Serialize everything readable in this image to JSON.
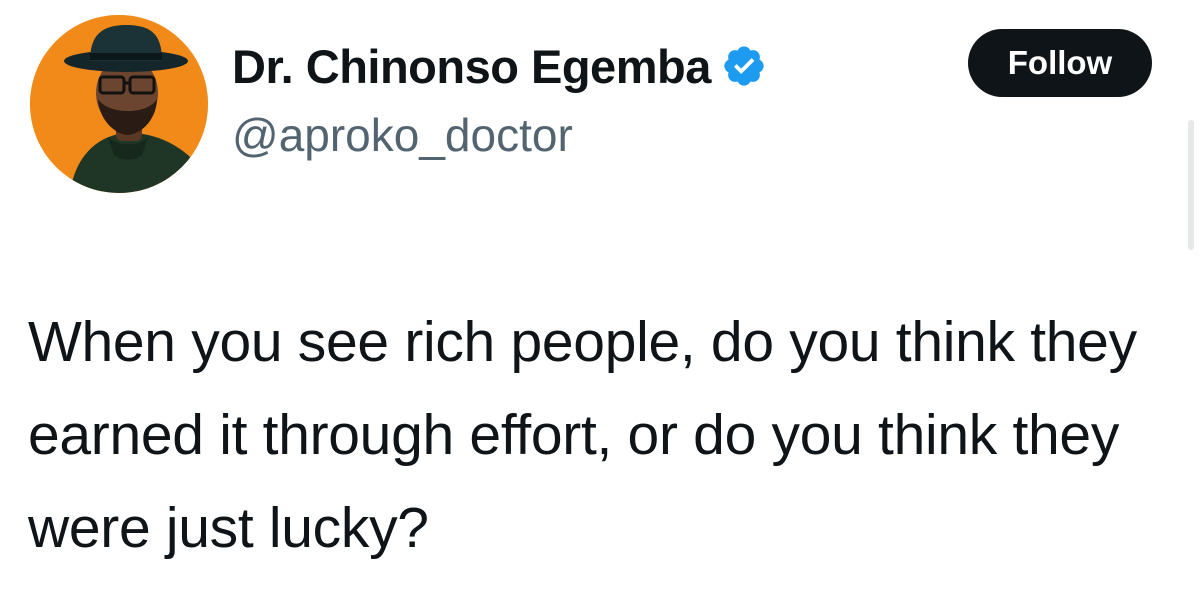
{
  "tweet": {
    "author": {
      "display_name": "Dr. Chinonso Egemba",
      "handle": "@aproko_doctor",
      "verified": true,
      "avatar_icon": "profile-photo",
      "verified_icon": "verified-badge-icon"
    },
    "follow_label": "Follow",
    "text": "When you see rich people, do you think they earned it through effort, or do you think they were just lucky?"
  },
  "colors": {
    "text": "#0f1419",
    "secondary_text": "#536471",
    "follow_button_bg": "#0f1419",
    "follow_button_text": "#ffffff",
    "verified_blue": "#1d9bf0",
    "avatar_background": "#f28a1a"
  }
}
